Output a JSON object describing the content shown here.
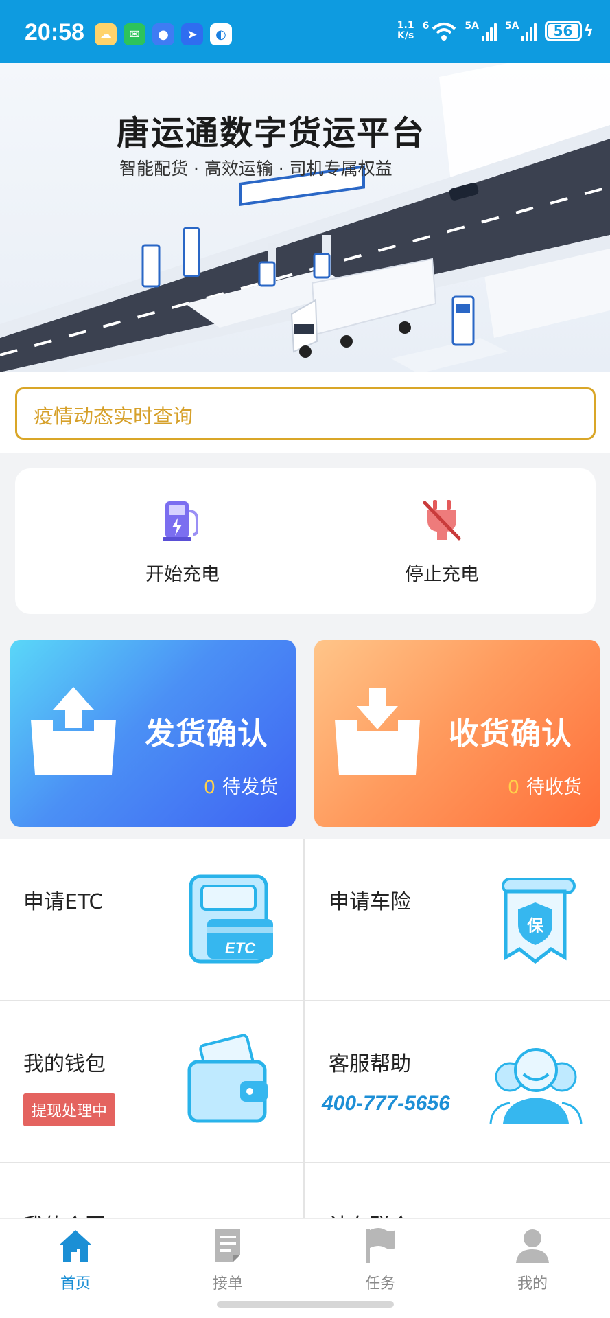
{
  "status_bar": {
    "time": "20:58",
    "net_speed_value": "1.1",
    "net_speed_unit": "K/s",
    "wifi_label": "6",
    "signal1_label": "5A",
    "signal2_label": "5A",
    "battery": "56",
    "apps": [
      "cloud-icon",
      "wechat-icon",
      "message-icon",
      "arrow-app-icon",
      "browser-icon"
    ]
  },
  "banner": {
    "title": "唐运通数字货运平台",
    "subtitle": "智能配货 · 高效运输 · 司机专属权益"
  },
  "epidemic_query": {
    "label": "疫情动态实时查询"
  },
  "charging": {
    "start_label": "开始充电",
    "stop_label": "停止充电"
  },
  "shipping": {
    "send_title": "发货确认",
    "send_count": "0",
    "send_status": "待发货",
    "receive_title": "收货确认",
    "receive_count": "0",
    "receive_status": "待收货"
  },
  "services": {
    "etc": "申请ETC",
    "insurance": "申请车险",
    "insurance_stamp": "保",
    "etc_card_text": "ETC",
    "wallet": "我的钱包",
    "wallet_badge": "提现处理中",
    "support": "客服帮助",
    "support_phone": "400-777-5656",
    "row3_left": "我的合同",
    "row3_right": "认车联合"
  },
  "tabbar": {
    "home": "首页",
    "orders": "接单",
    "tasks": "任务",
    "mine": "我的"
  },
  "colors": {
    "primary": "#0e9be0",
    "accent_gold": "#d9a628",
    "badge_red": "#e4635f",
    "phone_blue": "#1d8fd6"
  }
}
